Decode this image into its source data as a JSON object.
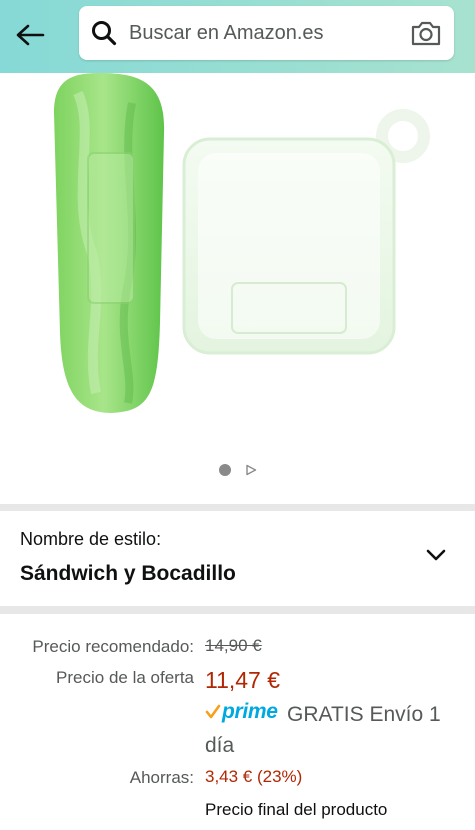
{
  "header": {
    "search_placeholder": "Buscar en Amazon.es",
    "back_icon": "arrow-left-icon",
    "search_icon": "magnifier-icon",
    "camera_icon": "camera-icon",
    "background_gradient": [
      "#86d9d6",
      "#a7e2cf"
    ]
  },
  "carousel": {
    "total_dots": 1,
    "has_video": true
  },
  "style": {
    "label": "Nombre de estilo:",
    "value": "Sándwich y Bocadillo"
  },
  "price": {
    "list_label": "Precio recomendado:",
    "list_value": "14,90 €",
    "deal_label": "Precio de la oferta",
    "deal_value": "11,47 €",
    "prime_mark": "prime",
    "shipping": "GRATIS Envío 1 día",
    "savings_label": "Ahorras:",
    "savings_value": "3,43 € (23%)",
    "final_note": "Precio final del producto"
  },
  "colors": {
    "price_red": "#b12704",
    "prime_blue": "#00a8e1",
    "prime_check": "#f7a11a",
    "muted_text": "#565959"
  }
}
